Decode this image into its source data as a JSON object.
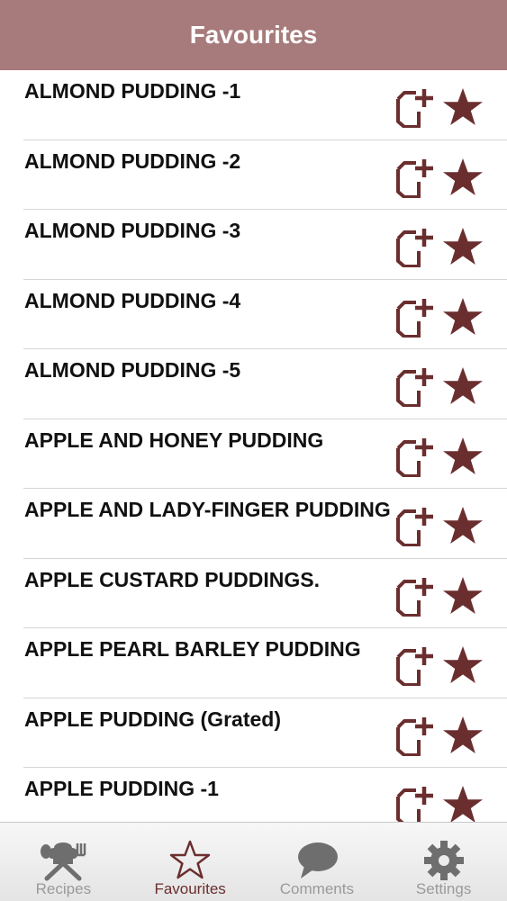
{
  "header": {
    "title": "Favourites"
  },
  "colors": {
    "header_bg": "#a77b7b",
    "accent": "#6b2e2e",
    "tab_inactive": "#9a9a9a"
  },
  "items": [
    {
      "title": "ALMOND PUDDING -1"
    },
    {
      "title": "ALMOND PUDDING -2"
    },
    {
      "title": "ALMOND PUDDING -3"
    },
    {
      "title": "ALMOND PUDDING -4"
    },
    {
      "title": "ALMOND PUDDING -5"
    },
    {
      "title": "APPLE AND HONEY PUDDING"
    },
    {
      "title": "APPLE AND LADY-FINGER PUDDING"
    },
    {
      "title": "APPLE CUSTARD PUDDINGS."
    },
    {
      "title": "APPLE PEARL BARLEY PUDDING"
    },
    {
      "title": "APPLE PUDDING (Grated)"
    },
    {
      "title": "APPLE PUDDING -1"
    }
  ],
  "item_icons": {
    "left": "add-note-icon",
    "right": "star-icon"
  },
  "tabs": [
    {
      "label": "Recipes",
      "icon": "chef-hat-utensils-icon",
      "active": false
    },
    {
      "label": "Favourites",
      "icon": "star-outline-icon",
      "active": true
    },
    {
      "label": "Comments",
      "icon": "speech-bubble-icon",
      "active": false
    },
    {
      "label": "Settings",
      "icon": "gear-icon",
      "active": false
    }
  ]
}
